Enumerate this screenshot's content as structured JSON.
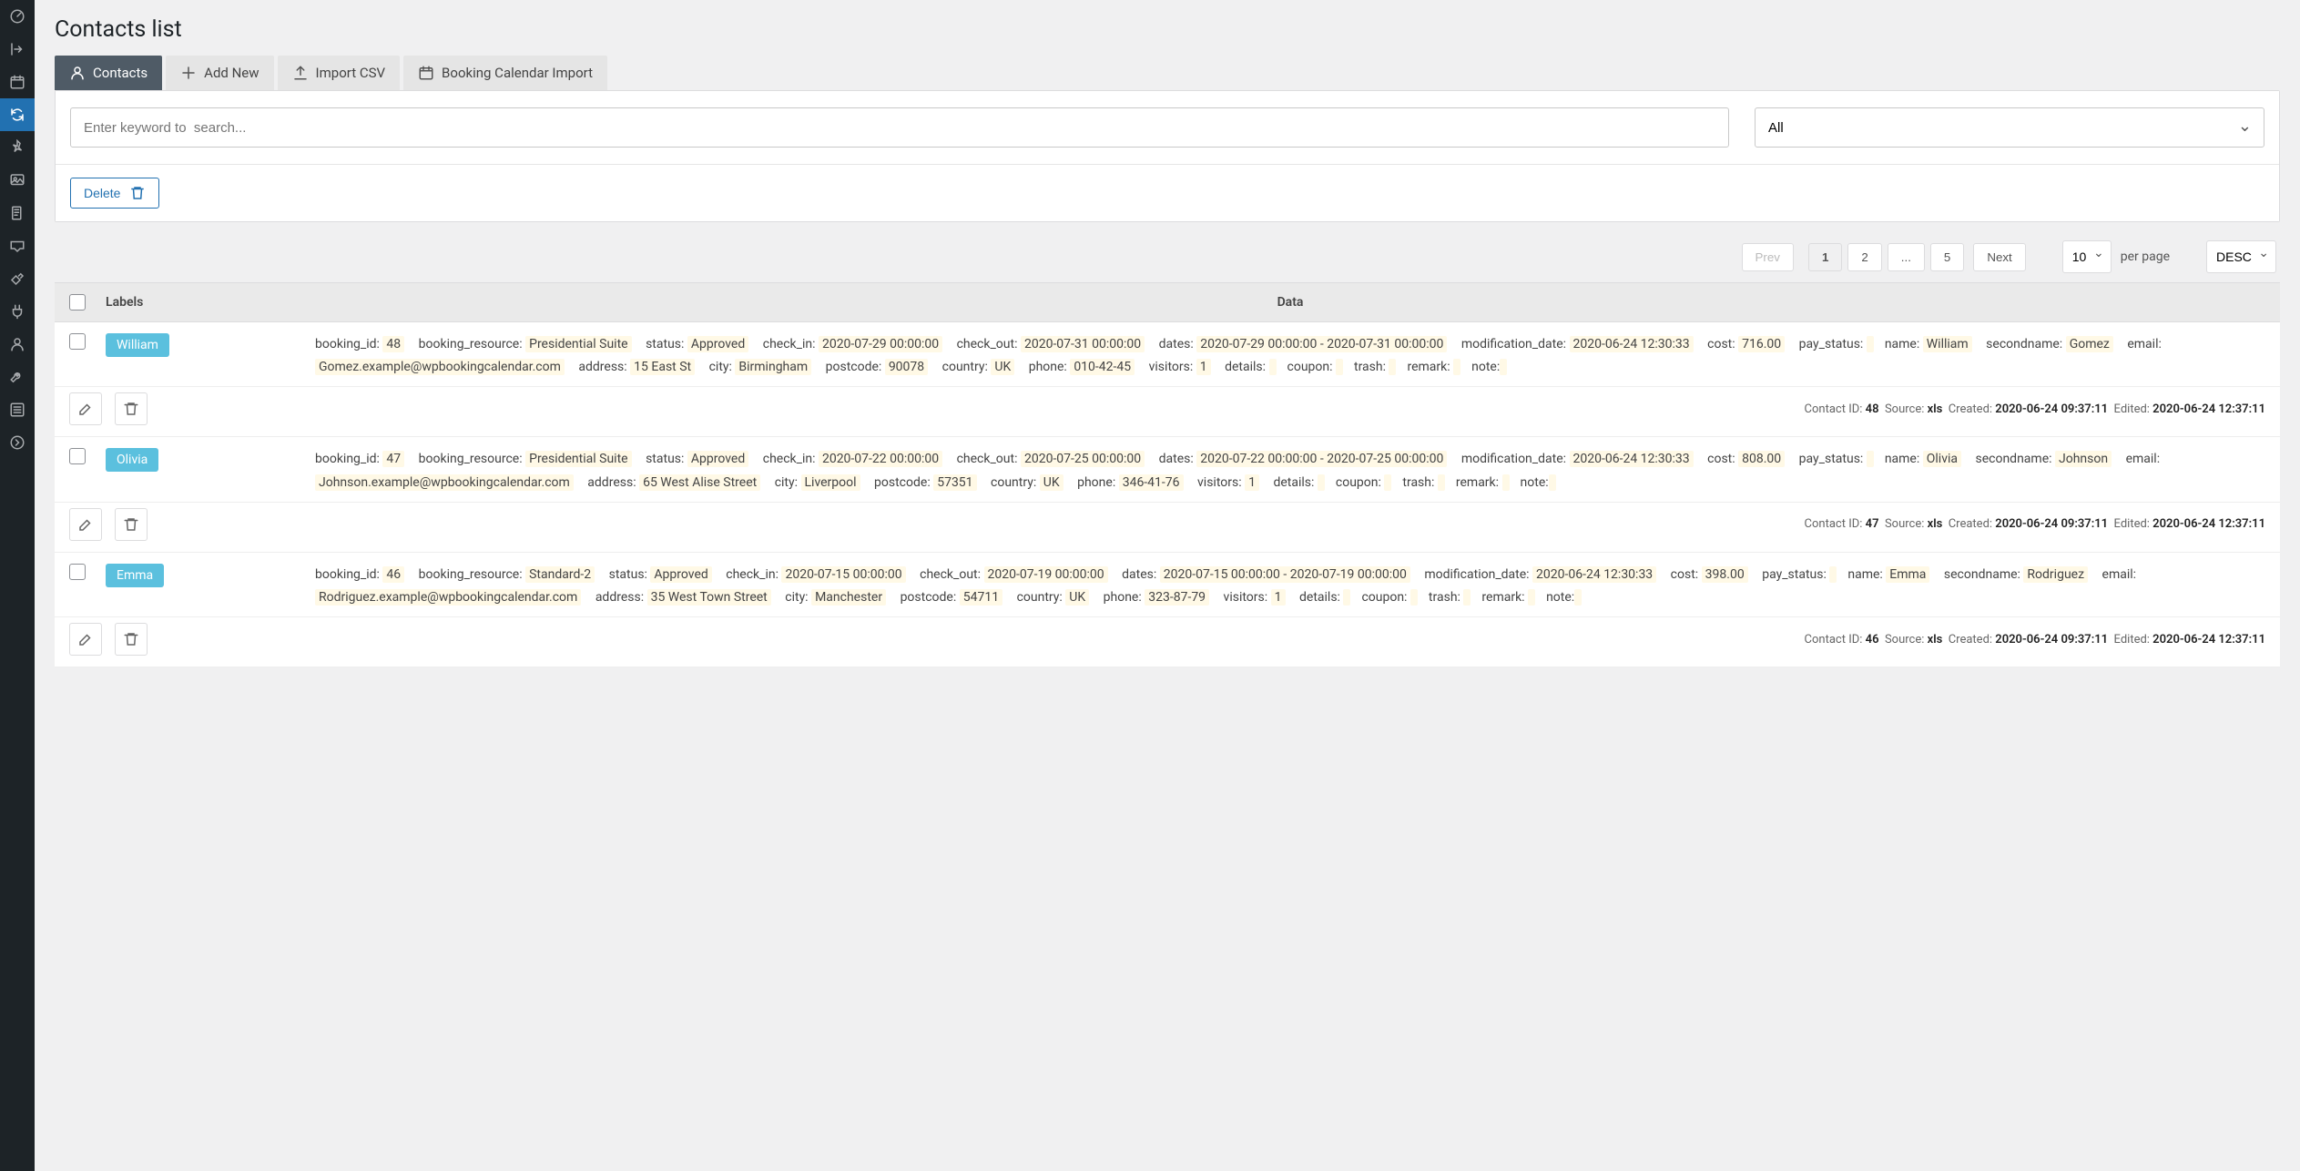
{
  "sidebar": {
    "items": [
      {
        "icon": "dashboard-icon"
      },
      {
        "icon": "arrow-right-icon"
      },
      {
        "icon": "calendar-icon"
      },
      {
        "icon": "refresh-icon",
        "active": true
      },
      {
        "icon": "pin-icon"
      },
      {
        "icon": "media-icon"
      },
      {
        "icon": "pages-icon"
      },
      {
        "icon": "comments-icon"
      },
      {
        "icon": "paint-icon"
      },
      {
        "icon": "plugins-icon"
      },
      {
        "icon": "users-icon"
      },
      {
        "icon": "tools-icon"
      },
      {
        "icon": "settings-icon"
      },
      {
        "icon": "collapse-icon"
      }
    ]
  },
  "page_title": "Contacts list",
  "tabs": [
    {
      "label": "Contacts",
      "icon": "user-icon",
      "active": true
    },
    {
      "label": "Add New",
      "icon": "plus-icon"
    },
    {
      "label": "Import CSV",
      "icon": "upload-icon"
    },
    {
      "label": "Booking Calendar Import",
      "icon": "calendar-icon"
    }
  ],
  "search": {
    "placeholder": "Enter keyword to  search..."
  },
  "filter": {
    "value": "All"
  },
  "delete_btn": "Delete",
  "pagination": {
    "prev": "Prev",
    "pages": [
      "1",
      "2",
      "...",
      "5"
    ],
    "next": "Next",
    "per_page_value": "10",
    "per_page_label": "per page",
    "sort": "DESC"
  },
  "table": {
    "header_labels": "Labels",
    "header_data": "Data"
  },
  "rows": [
    {
      "name": "William",
      "fields": [
        {
          "k": "booking_id",
          "v": "48"
        },
        {
          "k": "booking_resource",
          "v": "Presidential Suite"
        },
        {
          "k": "status",
          "v": "Approved"
        },
        {
          "k": "check_in",
          "v": "2020-07-29 00:00:00"
        },
        {
          "k": "check_out",
          "v": "2020-07-31 00:00:00"
        },
        {
          "k": "dates",
          "v": "2020-07-29 00:00:00 - 2020-07-31 00:00:00"
        },
        {
          "k": "modification_date",
          "v": "2020-06-24 12:30:33"
        },
        {
          "k": "cost",
          "v": "716.00"
        },
        {
          "k": "pay_status",
          "v": ""
        },
        {
          "k": "name",
          "v": "William"
        },
        {
          "k": "secondname",
          "v": "Gomez"
        },
        {
          "k": "email",
          "v": "Gomez.example@wpbookingcalendar.com"
        },
        {
          "k": "address",
          "v": "15 East St"
        },
        {
          "k": "city",
          "v": "Birmingham"
        },
        {
          "k": "postcode",
          "v": "90078"
        },
        {
          "k": "country",
          "v": "UK"
        },
        {
          "k": "phone",
          "v": "010-42-45"
        },
        {
          "k": "visitors",
          "v": "1"
        },
        {
          "k": "details",
          "v": ""
        },
        {
          "k": "coupon",
          "v": ""
        },
        {
          "k": "trash",
          "v": ""
        },
        {
          "k": "remark",
          "v": ""
        },
        {
          "k": "note",
          "v": ""
        }
      ],
      "meta": {
        "id": "48",
        "source": "xls",
        "created": "2020-06-24 09:37:11",
        "edited": "2020-06-24 12:37:11"
      }
    },
    {
      "name": "Olivia",
      "fields": [
        {
          "k": "booking_id",
          "v": "47"
        },
        {
          "k": "booking_resource",
          "v": "Presidential Suite"
        },
        {
          "k": "status",
          "v": "Approved"
        },
        {
          "k": "check_in",
          "v": "2020-07-22 00:00:00"
        },
        {
          "k": "check_out",
          "v": "2020-07-25 00:00:00"
        },
        {
          "k": "dates",
          "v": "2020-07-22 00:00:00 - 2020-07-25 00:00:00"
        },
        {
          "k": "modification_date",
          "v": "2020-06-24 12:30:33"
        },
        {
          "k": "cost",
          "v": "808.00"
        },
        {
          "k": "pay_status",
          "v": ""
        },
        {
          "k": "name",
          "v": "Olivia"
        },
        {
          "k": "secondname",
          "v": "Johnson"
        },
        {
          "k": "email",
          "v": "Johnson.example@wpbookingcalendar.com"
        },
        {
          "k": "address",
          "v": "65 West Alise Street"
        },
        {
          "k": "city",
          "v": "Liverpool"
        },
        {
          "k": "postcode",
          "v": "57351"
        },
        {
          "k": "country",
          "v": "UK"
        },
        {
          "k": "phone",
          "v": "346-41-76"
        },
        {
          "k": "visitors",
          "v": "1"
        },
        {
          "k": "details",
          "v": ""
        },
        {
          "k": "coupon",
          "v": ""
        },
        {
          "k": "trash",
          "v": ""
        },
        {
          "k": "remark",
          "v": ""
        },
        {
          "k": "note",
          "v": ""
        }
      ],
      "meta": {
        "id": "47",
        "source": "xls",
        "created": "2020-06-24 09:37:11",
        "edited": "2020-06-24 12:37:11"
      }
    },
    {
      "name": "Emma",
      "fields": [
        {
          "k": "booking_id",
          "v": "46"
        },
        {
          "k": "booking_resource",
          "v": "Standard-2"
        },
        {
          "k": "status",
          "v": "Approved"
        },
        {
          "k": "check_in",
          "v": "2020-07-15 00:00:00"
        },
        {
          "k": "check_out",
          "v": "2020-07-19 00:00:00"
        },
        {
          "k": "dates",
          "v": "2020-07-15 00:00:00 - 2020-07-19 00:00:00"
        },
        {
          "k": "modification_date",
          "v": "2020-06-24 12:30:33"
        },
        {
          "k": "cost",
          "v": "398.00"
        },
        {
          "k": "pay_status",
          "v": ""
        },
        {
          "k": "name",
          "v": "Emma"
        },
        {
          "k": "secondname",
          "v": "Rodriguez"
        },
        {
          "k": "email",
          "v": "Rodriguez.example@wpbookingcalendar.com"
        },
        {
          "k": "address",
          "v": "35 West Town Street"
        },
        {
          "k": "city",
          "v": "Manchester"
        },
        {
          "k": "postcode",
          "v": "54711"
        },
        {
          "k": "country",
          "v": "UK"
        },
        {
          "k": "phone",
          "v": "323-87-79"
        },
        {
          "k": "visitors",
          "v": "1"
        },
        {
          "k": "details",
          "v": ""
        },
        {
          "k": "coupon",
          "v": ""
        },
        {
          "k": "trash",
          "v": ""
        },
        {
          "k": "remark",
          "v": ""
        },
        {
          "k": "note",
          "v": ""
        }
      ],
      "meta": {
        "id": "46",
        "source": "xls",
        "created": "2020-06-24 09:37:11",
        "edited": "2020-06-24 12:37:11"
      }
    }
  ],
  "meta_labels": {
    "contact_id": "Contact ID:",
    "source": "Source:",
    "created": "Created:",
    "edited": "Edited:"
  }
}
